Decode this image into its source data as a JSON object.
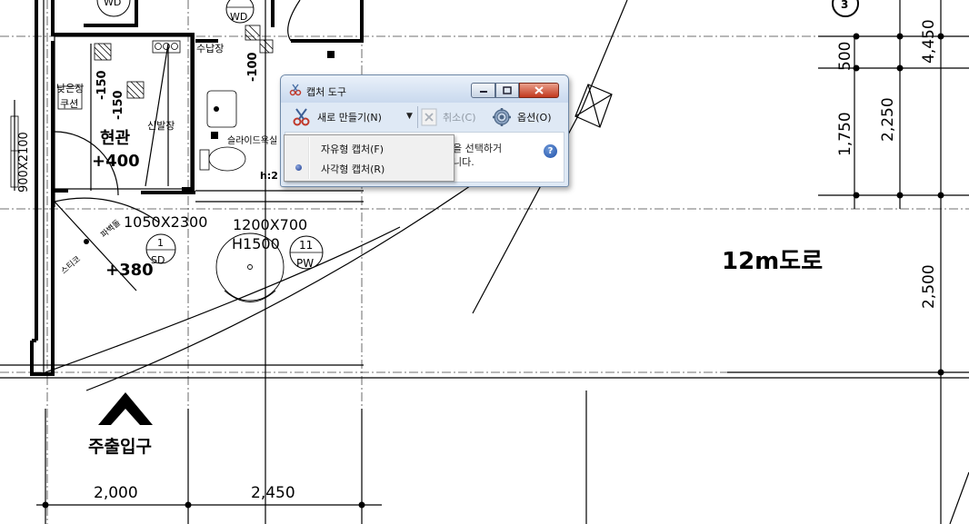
{
  "drawing": {
    "rooms": {
      "entrance": "현관",
      "entrance_level": "+400",
      "low_shoe_cabinet_a": "낮은장",
      "low_shoe_cabinet_b": "쿠션",
      "shoe_cabinet": "신발장",
      "storage": "수납장",
      "sliding_bath": "슬라이드욕실",
      "front_level": "+380",
      "road": "12m도로",
      "main_entrance": "주출입구",
      "h_note": "h:2"
    },
    "dimensions": {
      "minus150_a": "-150",
      "minus150_b": "-150",
      "minus100": "-100",
      "door_900": "900X2100",
      "door_1050": "1050X2300",
      "window_1200": "1200X700",
      "window_h1500": "H1500",
      "right_4450": "4,450",
      "right_500": "500",
      "right_2250": "2,250",
      "right_1750": "1,750",
      "right_2500": "2,500",
      "bottom_2000": "2,000",
      "bottom_2450": "2,450"
    },
    "tags": {
      "wd1": "WD",
      "wd2": "WD",
      "sd_num": "1",
      "sd_code": "SD",
      "pw_num": "11",
      "pw_code": "PW",
      "grid_3": "3"
    },
    "diagonal_labels": {
      "tl1": "파벽돌",
      "tl2": "스티코"
    }
  },
  "snipping_tool": {
    "title": "캡처 도구",
    "new_label": "새로 만들기(N)",
    "cancel_label": "취소(C)",
    "options_label": "옵션(O)",
    "content_text": "을 선택하거\n니다.",
    "help_glyph": "?",
    "menu": {
      "items": [
        {
          "label": "자유형 캡처(F)",
          "selected": false
        },
        {
          "label": "사각형 캡처(R)",
          "selected": true
        }
      ]
    }
  },
  "colors": {
    "close_button": "#c2381d",
    "titlebar": "#c9d9ee",
    "drawing_line": "#000000"
  }
}
